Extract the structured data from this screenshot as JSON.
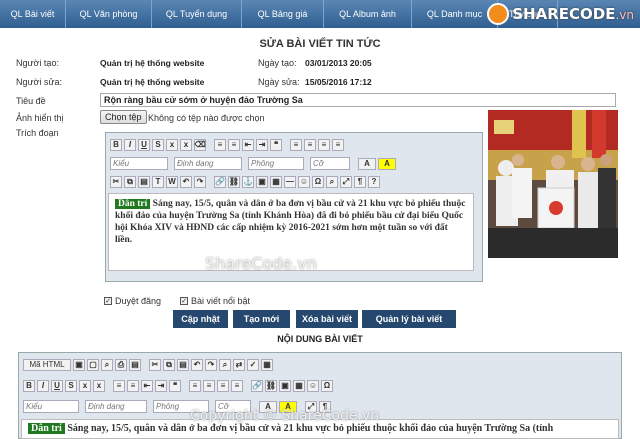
{
  "nav": {
    "tabs": [
      "QL Bài viết",
      "QL Văn phòng",
      "QL Tuyển dụng",
      "QL Bảng giá",
      "QL Album ảnh",
      "QL Danh mục",
      "Tùy chọn"
    ]
  },
  "logo": {
    "text": "SHARECODE",
    "suffix": ".vn"
  },
  "page": {
    "title": "SỬA BÀI VIẾT TIN TỨC"
  },
  "meta": {
    "creator_label": "Người tạo:",
    "creator": "Quản trị hệ thống website",
    "created_label": "Ngày tạo:",
    "created": "03/01/2013 20:05",
    "editor_label": "Người sửa:",
    "editor": "Quản trị hệ thống website",
    "edited_label": "Ngày sửa:",
    "edited": "15/05/2016 17:12"
  },
  "form": {
    "title_label": "Tiêu đề",
    "title_value": "Rộn ràng bầu cử sớm ở huyện đảo Trường Sa",
    "image_label": "Ảnh hiển thị",
    "choose_file": "Chọn tệp",
    "no_file": "Không có tệp nào được chọn",
    "summary_label": "Trích đoạn"
  },
  "editor1": {
    "style": "Kiểu",
    "format": "Định dạng",
    "font": "Phông",
    "size": "Cỡ",
    "tag": "Dân trí",
    "text": "Sáng nay, 15/5, quân và dân ở ba đơn vị bầu cử và 21 khu vực bỏ phiếu thuộc khối đảo của huyện Trường Sa (tỉnh Khánh Hòa) đã đi bỏ phiếu bầu cử đại biểu Quốc hội Khóa XIV và HĐND các cấp nhiệm kỳ 2016-2021 sớm hơn một tuần so với đất liền."
  },
  "options": {
    "published": "Duyệt đăng",
    "featured": "Bài viết nổi bật"
  },
  "actions": {
    "update": "Cập nhật",
    "new": "Tạo mới",
    "delete": "Xóa bài viết",
    "manage": "Quản lý bài viết"
  },
  "content_section": {
    "title": "NỘI DUNG BÀI VIẾT"
  },
  "editor2": {
    "source": "Mã HTML",
    "style": "Kiểu",
    "format": "Định dạng",
    "font": "Phông",
    "size": "Cỡ",
    "tag": "Dân trí",
    "text": "Sáng nay, 15/5, quân và dân ở ba đơn vị bầu cử và 21 khu vực bỏ phiếu thuộc khối đảo của huyện Trường Sa (tỉnh"
  },
  "watermarks": {
    "center": "ShareCode.vn",
    "bottom": "Copyright © ShareCode.vn"
  }
}
